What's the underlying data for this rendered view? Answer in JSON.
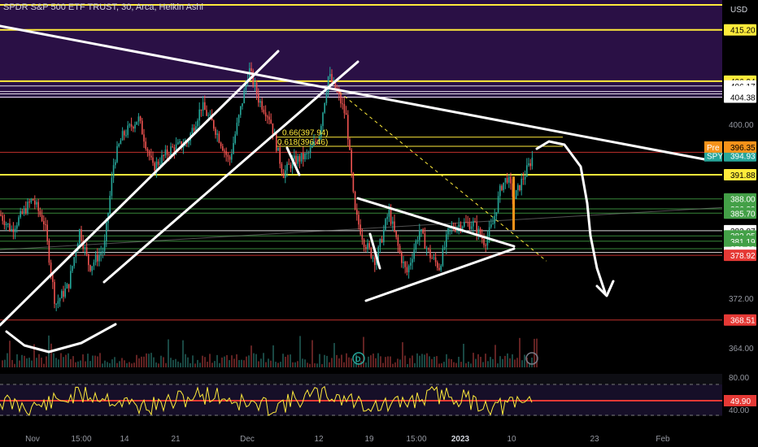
{
  "header": {
    "title": "SPDR S&P 500 ETF TRUST, 30, Arca, Heikin Ashi"
  },
  "currency": "USD",
  "chart_data": {
    "type": "candlestick",
    "series_name": "SPY",
    "candle_type": "Heikin Ashi",
    "interval": "30",
    "exchange": "Arca",
    "y_range": [
      360.5,
      420.0
    ],
    "price_scale_labels": [
      "400.00",
      "372.00",
      "364.00"
    ],
    "time_axis_labels": [
      "Nov",
      "15:00",
      "14",
      "21",
      "Dec",
      "12",
      "19",
      "15:00",
      "2023",
      "10",
      "23",
      "Feb"
    ],
    "last_price": {
      "label": "SPY",
      "value": "394.93",
      "color": "#26a69a"
    },
    "premarket": {
      "label": "Pre",
      "value": "396.35",
      "color": "#f7931a"
    },
    "levels": [
      {
        "value": "415.20",
        "color": "#ffeb3b",
        "text": "#000000"
      },
      {
        "value": "406.94",
        "color": "#ffeb3b",
        "text": "#000000"
      },
      {
        "value": "406.17",
        "color": "#ffffff",
        "text": "#000000"
      },
      {
        "value": "405.27",
        "color": "#ffffff",
        "text": "#000000"
      },
      {
        "value": "404.90",
        "color": "#ffffff",
        "text": "#000000"
      },
      {
        "value": "404.38",
        "color": "#ffffff",
        "text": "#000000"
      },
      {
        "value": "395.49",
        "color": "#e53935",
        "text": "#ffffff"
      },
      {
        "value": "391.88",
        "color": "#ffeb3b",
        "text": "#000000"
      },
      {
        "value": "388.00",
        "color": "#43a047",
        "text": "#ffffff"
      },
      {
        "value": "386.39",
        "color": "#43a047",
        "text": "#ffffff"
      },
      {
        "value": "385.70",
        "color": "#43a047",
        "text": "#ffffff"
      },
      {
        "value": "382.87",
        "color": "#ffffff",
        "text": "#000000"
      },
      {
        "value": "382.05",
        "color": "#43a047",
        "text": "#ffffff"
      },
      {
        "value": "381.19",
        "color": "#43a047",
        "text": "#ffffff"
      },
      {
        "value": "379.99",
        "color": "#43a047",
        "text": "#ffffff"
      },
      {
        "value": "379.38",
        "color": "#ffffff",
        "text": "#000000"
      },
      {
        "value": "378.92",
        "color": "#e53935",
        "text": "#ffffff"
      },
      {
        "value": "368.51",
        "color": "#e53935",
        "text": "#ffffff"
      }
    ],
    "fib_levels": [
      {
        "label": "0.66(397.94)",
        "value": 397.94
      },
      {
        "label": "0.618(396.46)",
        "value": 396.46
      }
    ],
    "rsi": {
      "labels": [
        "80.00",
        "40.00"
      ],
      "value": "49.90",
      "overbought": 80,
      "oversold": 20,
      "color": "#ffeb3b"
    },
    "event_markers": [
      "D"
    ],
    "colors": {
      "up": "#26a69a",
      "down": "#ef5350",
      "resistance_zone": "#2a1045",
      "fib": "#ffeb3b"
    }
  }
}
